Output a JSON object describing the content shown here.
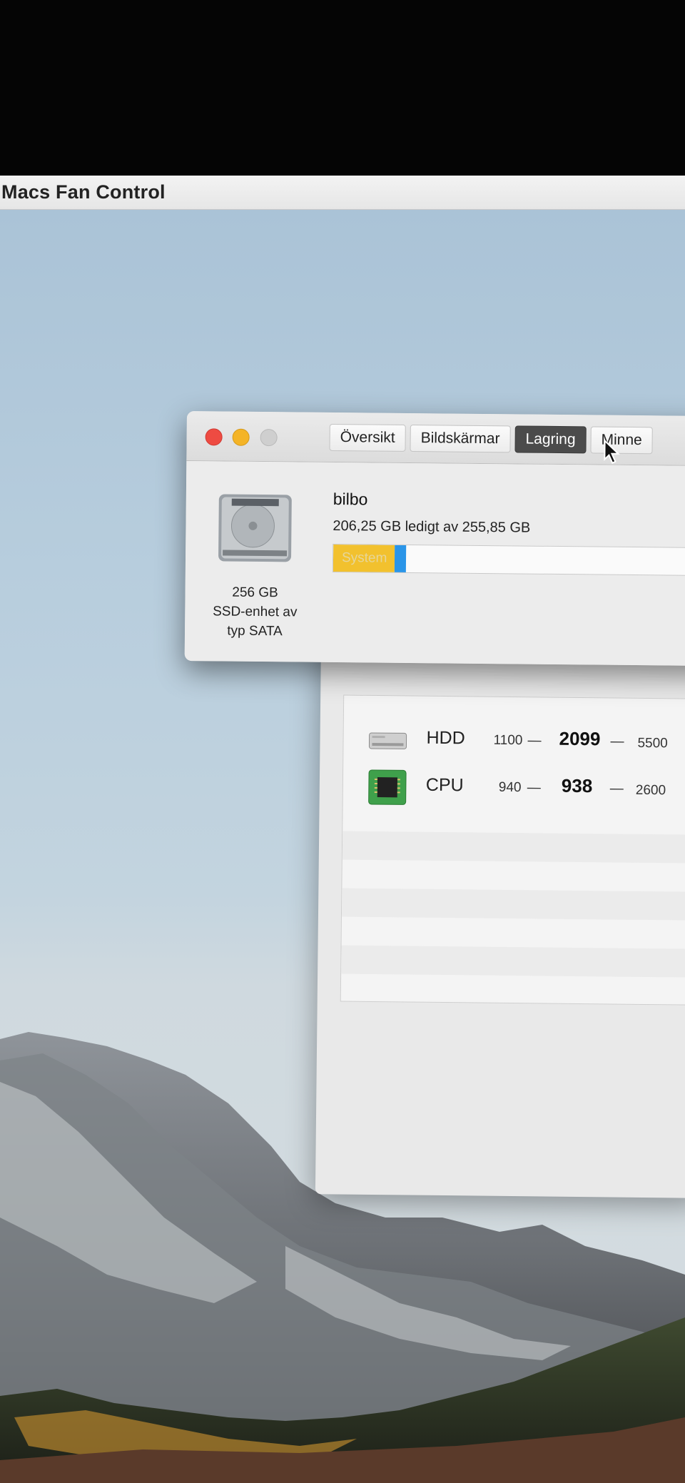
{
  "menubar": {
    "app_name": "Macs Fan Control"
  },
  "about_window": {
    "tabs": [
      {
        "label": "Översikt",
        "active": false
      },
      {
        "label": "Bildskärmar",
        "active": false
      },
      {
        "label": "Lagring",
        "active": true
      },
      {
        "label": "Minne",
        "active": false
      }
    ],
    "volume_name": "bilbo",
    "free_text": "206,25 GB ledigt av 255,85 GB",
    "drive_capacity": "256 GB",
    "drive_type_line1": "SSD-enhet av",
    "drive_type_line2": "typ SATA",
    "usage": {
      "free_gb": 206.25,
      "total_gb": 255.85,
      "segments": [
        {
          "label": "System",
          "fraction": 0.16,
          "color": "#f2c12e"
        },
        {
          "label": "",
          "fraction": 0.03,
          "color": "#2a95e8"
        }
      ]
    }
  },
  "fans": [
    {
      "name": "HDD",
      "min": "1100",
      "current": "2099",
      "max": "5500",
      "icon": "hdd-icon"
    },
    {
      "name": "CPU",
      "min": "940",
      "current": "938",
      "max": "2600",
      "icon": "cpu-chip-icon"
    }
  ],
  "fan_separator": "—",
  "traffic_lights": {
    "close": "#ee4b42",
    "minimize": "#f4b427",
    "zoom": "#cfcfcf"
  }
}
